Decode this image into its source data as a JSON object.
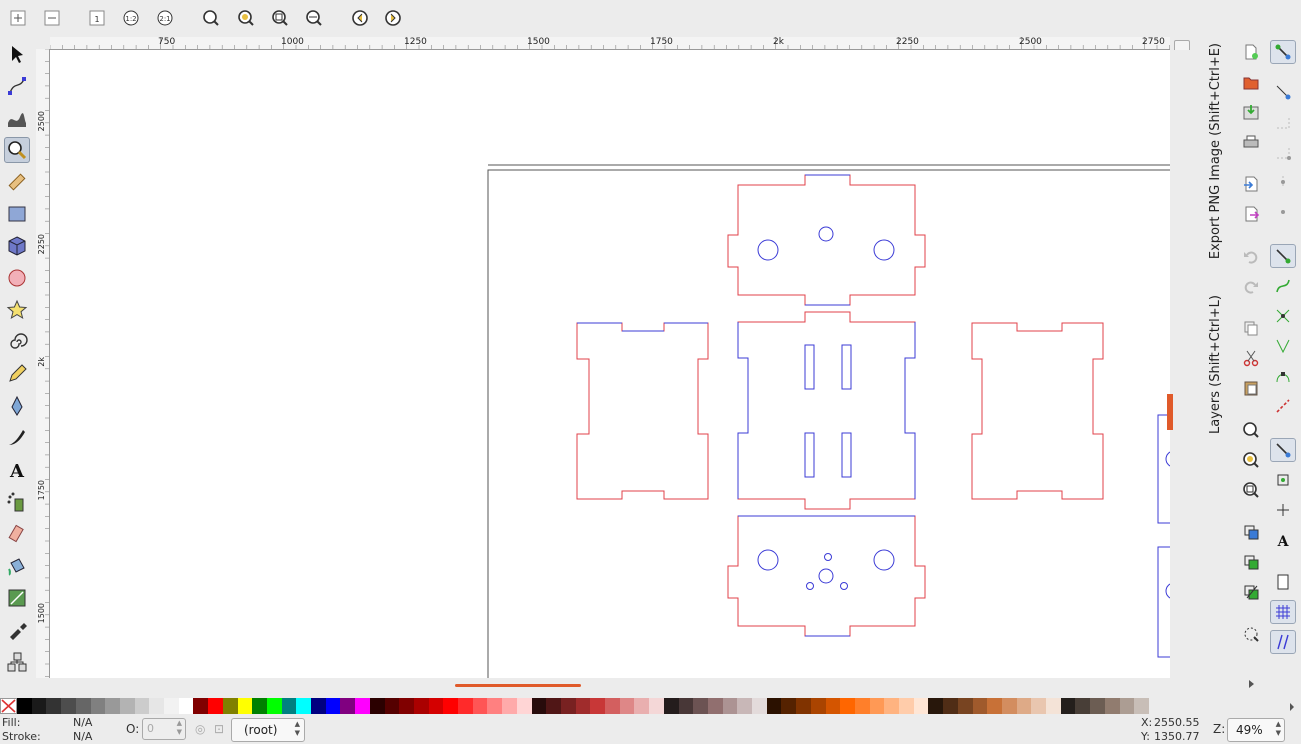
{
  "rulers": {
    "top_labels": [
      "750",
      "1000",
      "1250",
      "1500",
      "1750",
      "2k",
      "2250",
      "2500",
      "2750"
    ],
    "left_labels": [
      "2500",
      "2250",
      "2k",
      "1750",
      "1500"
    ]
  },
  "dock": {
    "tab_export": "Export PNG Image (Shift+Ctrl+E)",
    "tab_layers": "Layers (Shift+Ctrl+L)"
  },
  "status": {
    "fill_label": "Fill:",
    "fill_value": "N/A",
    "stroke_label": "Stroke:",
    "stroke_value": "N/A",
    "opacity_label": "O:",
    "opacity_value": "0",
    "layer_value": "(root)",
    "x_label": "X:",
    "x_value": "2550.55",
    "y_label": "Y:",
    "y_value": "1350.77",
    "zoom_label": "Z:",
    "zoom_value": "49%"
  },
  "colors": {
    "accent": "#e05a2a",
    "cut_red": "#e0404a",
    "cut_blue": "#3b3bd6"
  },
  "palette": [
    "#000000",
    "#1a1a1a",
    "#333333",
    "#4d4d4d",
    "#666666",
    "#808080",
    "#999999",
    "#b3b3b3",
    "#cccccc",
    "#e6e6e6",
    "#f2f2f2",
    "#ffffff",
    "#800000",
    "#ff0000",
    "#808000",
    "#ffff00",
    "#008000",
    "#00ff00",
    "#008080",
    "#00ffff",
    "#000080",
    "#0000ff",
    "#800080",
    "#ff00ff",
    "#2b0000",
    "#550000",
    "#800000",
    "#aa0000",
    "#d40000",
    "#ff0000",
    "#ff2a2a",
    "#ff5555",
    "#ff8080",
    "#ffaaaa",
    "#ffd5d5",
    "#280b0b",
    "#501616",
    "#782121",
    "#a02c2c",
    "#c83737",
    "#d35f5f",
    "#de8787",
    "#e9afaf",
    "#f4d7d7",
    "#241c1c",
    "#483737",
    "#6c5353",
    "#916f6f",
    "#ac9393",
    "#c8b7b7",
    "#e3dbdb",
    "#2b1100",
    "#552200",
    "#803300",
    "#aa4400",
    "#d45500",
    "#ff6600",
    "#ff7f2a",
    "#ff9955",
    "#ffb380",
    "#ffccaa",
    "#ffe6d5",
    "#28170b",
    "#502d16",
    "#784421",
    "#a05a2c",
    "#c87137",
    "#d38d5f",
    "#deaa87",
    "#e9c6af",
    "#f4e3d7",
    "#241f1c",
    "#483e37",
    "#6c5d53",
    "#917c6f",
    "#ac9d93",
    "#c8beb7"
  ]
}
